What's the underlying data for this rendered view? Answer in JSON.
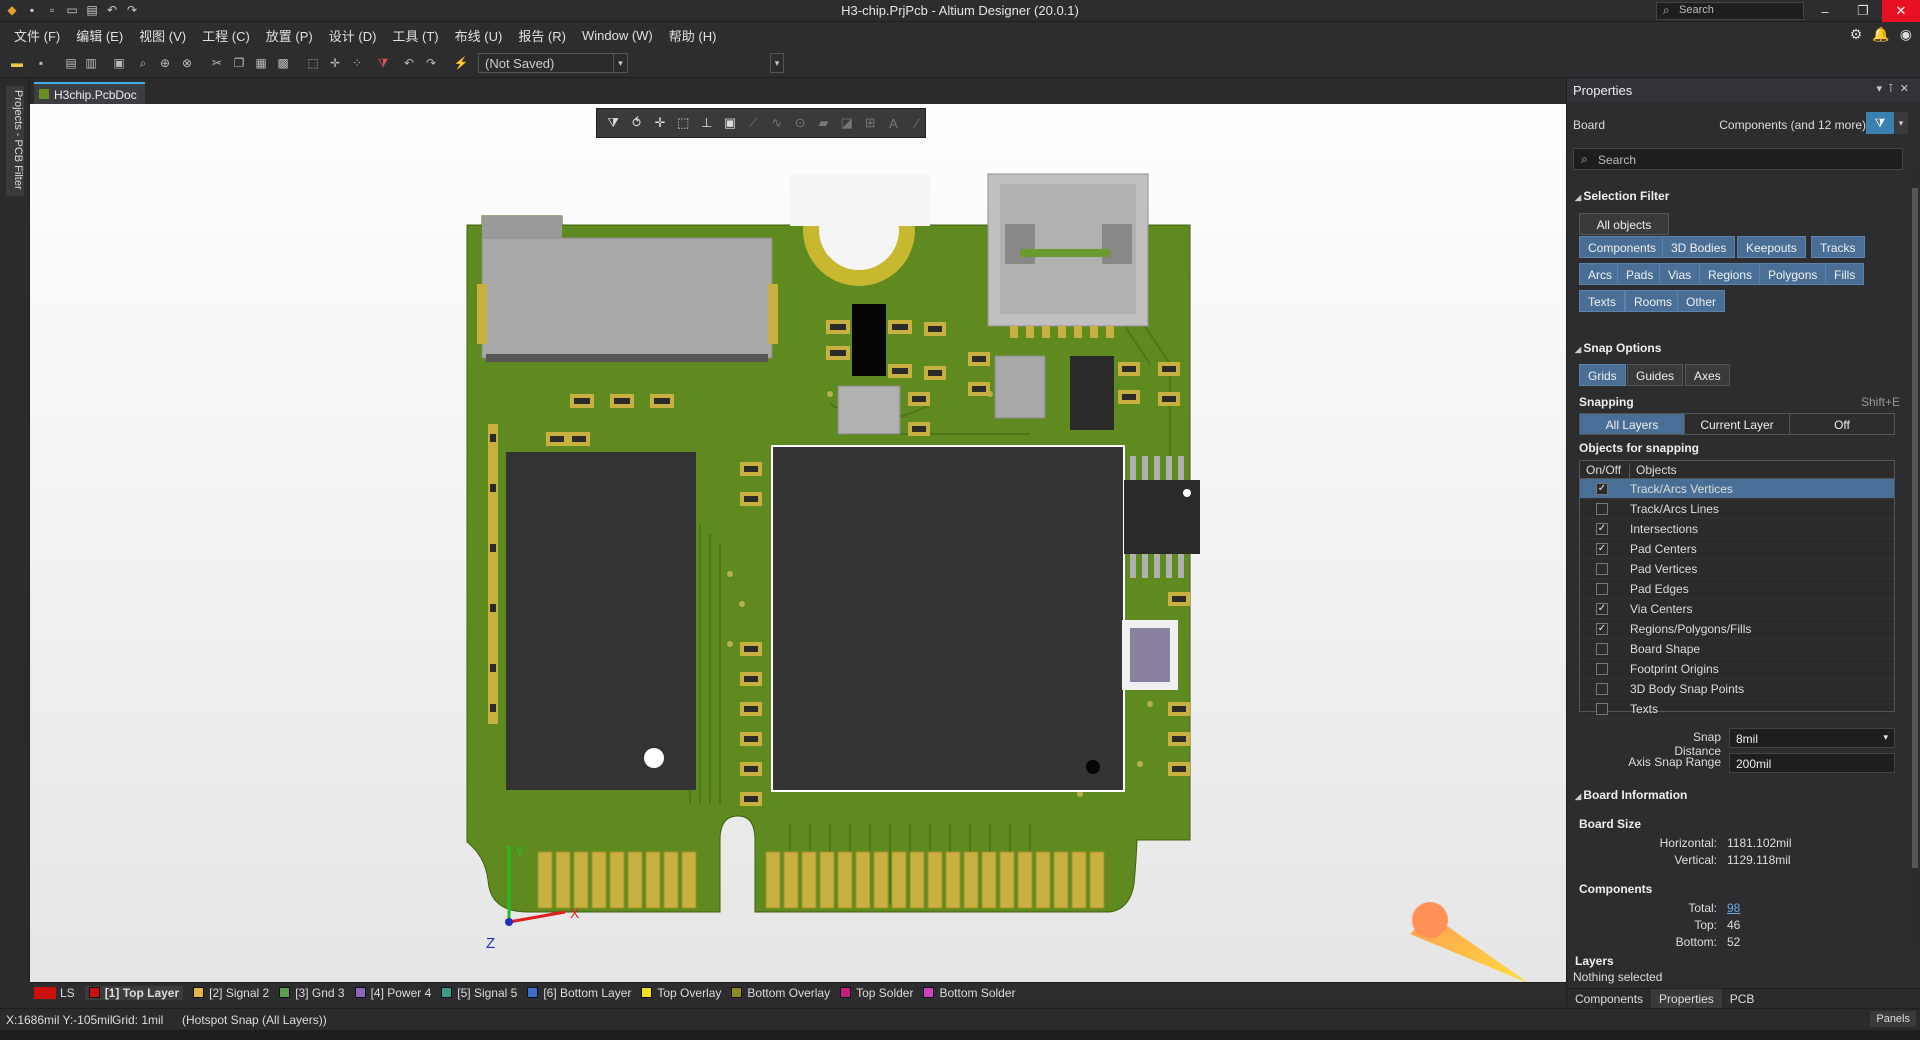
{
  "app": {
    "title": "H3-chip.PrjPcb - Altium Designer (20.0.1)",
    "search_placeholder": "Search",
    "window_buttons": [
      "–",
      "❐",
      "✕"
    ]
  },
  "menu": [
    "文件 (F)",
    "编辑 (E)",
    "视图 (V)",
    "工程 (C)",
    "放置 (P)",
    "设计 (D)",
    "工具 (T)",
    "布线 (U)",
    "报告 (R)",
    "Window (W)",
    "帮助 (H)"
  ],
  "toolbar": {
    "save_state": "(Not Saved)"
  },
  "left_panel_tab": "Projects - PCB Filter",
  "document_tab": "H3chip.PcbDoc",
  "canvas": {
    "axis_y": "Y",
    "axis_x": "X",
    "axis_z": "Z"
  },
  "layers": {
    "ls_label": "LS",
    "items": [
      {
        "label": "[1] Top Layer",
        "color": "#cc1010",
        "active": true
      },
      {
        "label": "[2] Signal 2",
        "color": "#e8b44a"
      },
      {
        "label": "[3] Gnd 3",
        "color": "#5aa050"
      },
      {
        "label": "[4] Power 4",
        "color": "#8a6ab8"
      },
      {
        "label": "[5] Signal 5",
        "color": "#3a9a8a"
      },
      {
        "label": "[6] Bottom Layer",
        "color": "#3a70c8"
      },
      {
        "label": "Top Overlay",
        "color": "#f0e020"
      },
      {
        "label": "Bottom Overlay",
        "color": "#8a8a20"
      },
      {
        "label": "Top Solder",
        "color": "#c02080"
      },
      {
        "label": "Bottom Solder",
        "color": "#d040c0"
      }
    ]
  },
  "status": {
    "coords": "X:1686mil Y:-105mil",
    "grid": "Grid: 1mil",
    "snap": "(Hotspot Snap (All Layers))",
    "panels": "Panels"
  },
  "properties": {
    "title": "Properties",
    "board_label": "Board",
    "components_filter": "Components (and 12 more)",
    "search_placeholder": "Search",
    "selection_filter": {
      "title": "Selection Filter",
      "all_objects": "All objects",
      "buttons_row1": [
        "Components",
        "3D Bodies",
        "Keepouts",
        "Tracks"
      ],
      "buttons_row2": [
        "Arcs",
        "Pads",
        "Vias",
        "Regions",
        "Polygons",
        "Fills"
      ],
      "buttons_row3": [
        "Texts",
        "Rooms",
        "Other"
      ]
    },
    "snap_options": {
      "title": "Snap Options",
      "buttons": [
        "Grids",
        "Guides",
        "Axes"
      ],
      "snapping_label": "Snapping",
      "shortcut": "Shift+E",
      "snapping_modes": [
        "All Layers",
        "Current Layer",
        "Off"
      ],
      "objects_label": "Objects for snapping",
      "col_onoff": "On/Off",
      "col_objects": "Objects",
      "objects": [
        {
          "name": "Track/Arcs Vertices",
          "on": true,
          "selected": true
        },
        {
          "name": "Track/Arcs Lines",
          "on": false
        },
        {
          "name": "Intersections",
          "on": true
        },
        {
          "name": "Pad Centers",
          "on": true
        },
        {
          "name": "Pad Vertices",
          "on": false
        },
        {
          "name": "Pad Edges",
          "on": false
        },
        {
          "name": "Via Centers",
          "on": true
        },
        {
          "name": "Regions/Polygons/Fills",
          "on": true
        },
        {
          "name": "Board Shape",
          "on": false
        },
        {
          "name": "Footprint Origins",
          "on": false
        },
        {
          "name": "3D Body Snap Points",
          "on": false
        },
        {
          "name": "Texts",
          "on": false
        }
      ],
      "snap_distance_label": "Snap Distance",
      "snap_distance": "8mil",
      "axis_snap_label": "Axis Snap Range",
      "axis_snap": "200mil"
    },
    "board_info": {
      "title": "Board Information",
      "size_label": "Board Size",
      "horizontal_label": "Horizontal:",
      "horizontal": "1181.102mil",
      "vertical_label": "Vertical:",
      "vertical": "1129.118mil",
      "components_label": "Components",
      "total_label": "Total:",
      "total": "98",
      "top_label": "Top:",
      "top": "46",
      "bottom_label": "Bottom:",
      "bottom": "52",
      "layers_label": "Layers"
    },
    "nothing_selected": "Nothing selected",
    "tabs": [
      "Components",
      "Properties",
      "PCB"
    ]
  }
}
